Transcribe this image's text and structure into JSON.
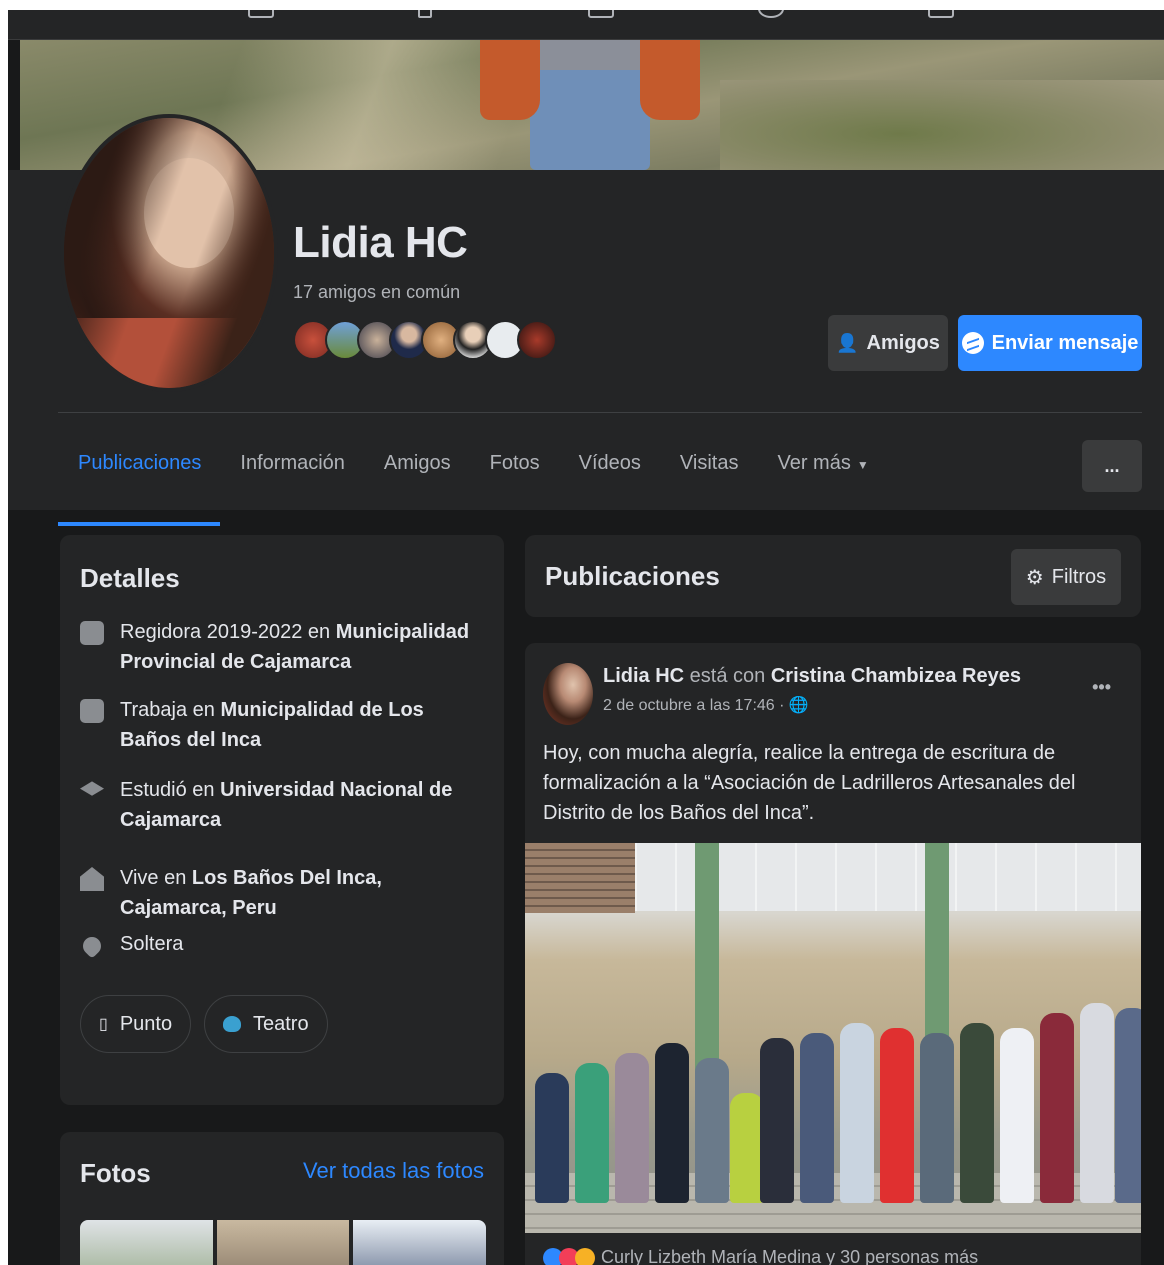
{
  "profile": {
    "name": "Lidia HC",
    "mutual_friends": "17 amigos en común",
    "friends_button": "Amigos",
    "message_button": "Enviar mensaje"
  },
  "tabs": [
    {
      "label": "Publicaciones",
      "active": true
    },
    {
      "label": "Información"
    },
    {
      "label": "Amigos"
    },
    {
      "label": "Fotos"
    },
    {
      "label": "Vídeos"
    },
    {
      "label": "Visitas"
    },
    {
      "label": "Ver más"
    }
  ],
  "more_menu": "...",
  "details": {
    "title": "Detalles",
    "items": [
      {
        "icon": "briefcase-icon",
        "prefix": "Regidora 2019-2022 en ",
        "bold": "Municipalidad Provincial de Cajamarca"
      },
      {
        "icon": "briefcase-icon",
        "prefix": "Trabaja en ",
        "bold": "Municipalidad de Los Baños del Inca"
      },
      {
        "icon": "graduation-cap-icon",
        "prefix": "Estudió en ",
        "bold": "Universidad Nacional de Cajamarca"
      },
      {
        "icon": "home-icon",
        "prefix": "Vive en ",
        "bold": "Los Baños Del Inca, Cajamarca, Peru"
      },
      {
        "icon": "heart-icon",
        "prefix": "Soltera",
        "bold": ""
      }
    ],
    "chips": [
      {
        "icon": "square-icon",
        "label": "Punto"
      },
      {
        "icon": "theater-mask-icon",
        "label": "Teatro"
      }
    ]
  },
  "photos": {
    "title": "Fotos",
    "see_all": "Ver todas las fotos"
  },
  "posts_header": {
    "title": "Publicaciones",
    "filter_button": "Filtros"
  },
  "post": {
    "author": "Lidia HC",
    "with_text": " está con ",
    "tagged": "Cristina Chambizea Reyes",
    "time": "2 de octubre a las 17:46 ·",
    "text": "Hoy, con mucha alegría, realice la entrega de escritura de formalización a la “Asociación de Ladrilleros  Artesanales del Distrito de los Baños del Inca”.",
    "reactions": "Curly Lizbeth María Medina y 30 personas más"
  },
  "colors": {
    "background": "#18191a",
    "card": "#242526",
    "accent": "#2d88ff",
    "text": "#e4e6eb",
    "secondary_text": "#b0b3b8"
  }
}
